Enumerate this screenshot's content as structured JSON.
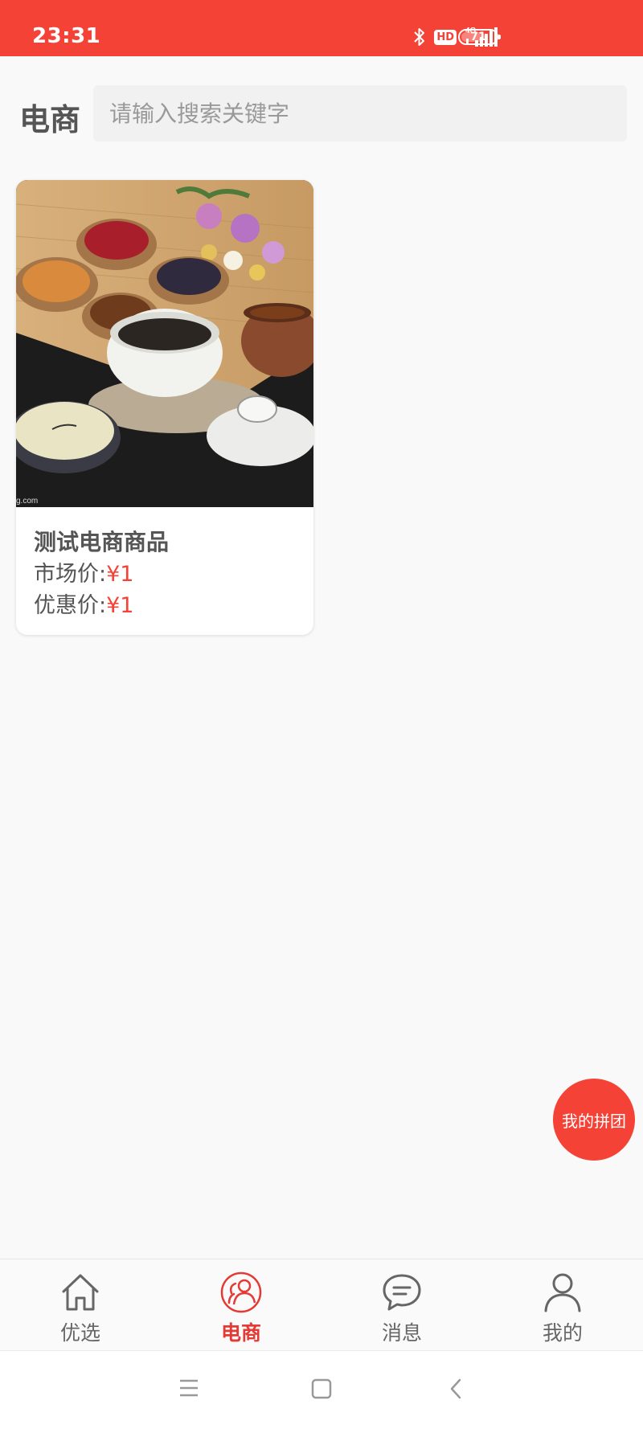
{
  "status_bar": {
    "time": "23:31",
    "hd_label": "HD",
    "network_label": "4G",
    "battery_level": "71",
    "icons": [
      "bluetooth-icon",
      "hd-icon",
      "signal-4g-icon",
      "battery-icon"
    ],
    "background_color": "#f44336"
  },
  "header": {
    "title": "电商",
    "search_placeholder": "请输入搜索关键字"
  },
  "products": [
    {
      "name": "测试电商商品",
      "market_price_label": "市场价:",
      "market_price": "¥1",
      "discount_price_label": "优惠价:",
      "discount_price": "¥1",
      "image_watermark": "g.com"
    }
  ],
  "fab": {
    "label": "我的拼团",
    "color": "#f44336"
  },
  "tabbar": {
    "active_color": "#e53935",
    "items": [
      {
        "label": "优选",
        "icon": "home-icon"
      },
      {
        "label": "电商",
        "icon": "group-users-icon",
        "active": true
      },
      {
        "label": "消息",
        "icon": "message-icon"
      },
      {
        "label": "我的",
        "icon": "user-icon"
      }
    ]
  },
  "system_nav": {
    "icons": [
      "menu-icon",
      "home-square-icon",
      "back-icon"
    ]
  }
}
